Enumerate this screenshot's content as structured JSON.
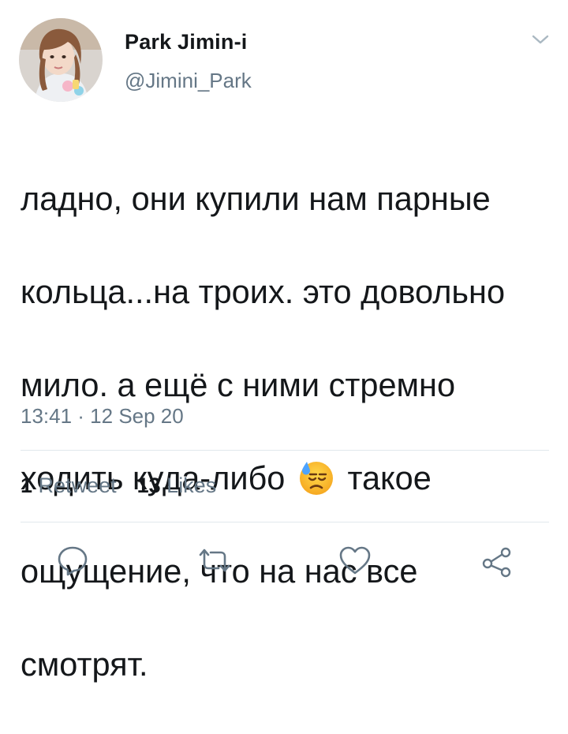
{
  "author": {
    "display_name": "Park Jimin-i",
    "handle": "@Jimini_Park",
    "avatar_icon": "profile-photo"
  },
  "tweet": {
    "lines": [
      "ладно, они купили нам парные",
      "кольца...на троих. это довольно",
      "мило. а ещё с ними стремно",
      "ходить куда-либо",
      "такое",
      "ощущение, что на нас все",
      "смотрят."
    ],
    "emoji_icon": "downcast-face-with-sweat-emoji",
    "timestamp": "13:41 · 12 Sep 20"
  },
  "stats": {
    "retweets_count": "1",
    "retweets_label": "Retweet",
    "likes_count": "13",
    "likes_label": "Likes"
  },
  "actions": [
    "reply-icon",
    "retweet-icon",
    "like-icon",
    "share-icon"
  ],
  "colors": {
    "text": "#14171a",
    "secondary": "#657786",
    "divider": "#e1e8ed",
    "icon": "#657786"
  }
}
